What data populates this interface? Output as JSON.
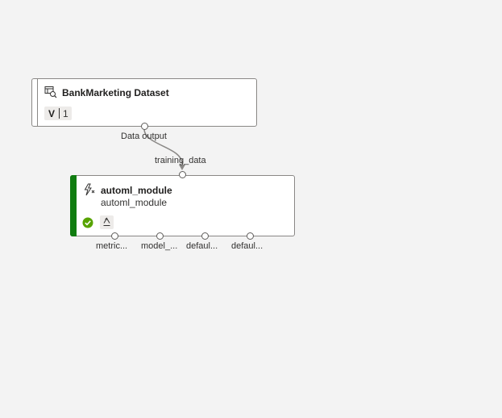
{
  "dataset_node": {
    "icon": "dataset-icon",
    "title": "BankMarketing Dataset",
    "version_prefix": "V",
    "version_number": "1",
    "output_port_label": "Data output"
  },
  "edge": {
    "from": "Data output",
    "to": "training_data",
    "color": "#8a8886"
  },
  "module_node": {
    "icon": "automl-lightning-icon",
    "title": "automl_module",
    "subtitle": "automl_module",
    "status": "completed",
    "status_color": "#57a300",
    "accent_color": "#107c10",
    "input_port_label": "training_data",
    "output_ports": [
      "metric...",
      "model_...",
      "defaul...",
      "defaul..."
    ]
  }
}
